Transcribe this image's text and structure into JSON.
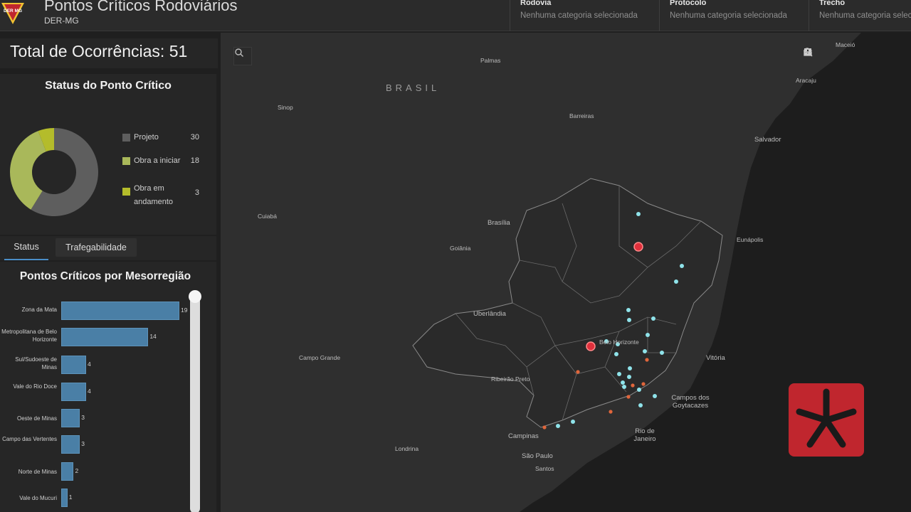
{
  "header": {
    "title": "Pontos Críticos Rodoviários",
    "subtitle": "DER-MG",
    "logo_text": "DER MG",
    "filters": [
      {
        "label": "Rodovia",
        "value": "Nenhuma categoria selecionada"
      },
      {
        "label": "Protocolo",
        "value": "Nenhuma categoria selecionada"
      },
      {
        "label": "Trecho",
        "value": "Nenhuma categoria seleciona"
      }
    ]
  },
  "total": {
    "text": "Total de Ocorrências: 51"
  },
  "status_card": {
    "title": "Status do Ponto Crítico",
    "legend": [
      {
        "name": "Projeto",
        "value": "30",
        "color": "#5e5e5e"
      },
      {
        "name": "Obra a iniciar",
        "value": "18",
        "color": "#a9b85a"
      },
      {
        "name": "Obra em andamento",
        "value": "3",
        "color": "#b4bc2b"
      }
    ]
  },
  "tabs": [
    {
      "label": "Status",
      "active": true
    },
    {
      "label": "Trafegabilidade",
      "active": false
    }
  ],
  "bar_card": {
    "title": "Pontos Críticos por Mesorregião"
  },
  "chart_data": [
    {
      "type": "pie",
      "title": "Status do Ponto Crítico",
      "categories": [
        "Projeto",
        "Obra a iniciar",
        "Obra em andamento"
      ],
      "values": [
        30,
        18,
        3
      ],
      "colors": [
        "#5e5e5e",
        "#a9b85a",
        "#b4bc2b"
      ],
      "donut": true
    },
    {
      "type": "bar",
      "orientation": "horizontal",
      "title": "Pontos Críticos por Mesorregião",
      "categories": [
        "Zona da Mata",
        "Metropolitana de Belo Horizonte",
        "Sul/Sudoeste de Minas",
        "Vale do Rio Doce",
        "Oeste de Minas",
        "Campo das Vertentes",
        "Norte de Minas",
        "Vale do Mucuri"
      ],
      "values": [
        19,
        14,
        4,
        4,
        3,
        3,
        2,
        1
      ],
      "color": "#4a7fa6"
    }
  ],
  "map": {
    "country_label": "BRASIL",
    "cities": [
      "Palmas",
      "Sinop",
      "Barreiras",
      "Aracaju",
      "Salvador",
      "Cuiabá",
      "Brasília",
      "Goiânia",
      "Eunápolis",
      "Uberlândia",
      "Belo Horizonte",
      "Campo Grande",
      "Ribeirão Preto",
      "Vitória",
      "Campos dos Goytacazes",
      "Campinas",
      "Rio de Janeiro",
      "Londrina",
      "São Paulo",
      "Santos",
      "Maceió"
    ],
    "point_colors": {
      "critical": "#e0303c",
      "normal": "#8fe3ea",
      "warning": "#e0663c"
    }
  }
}
